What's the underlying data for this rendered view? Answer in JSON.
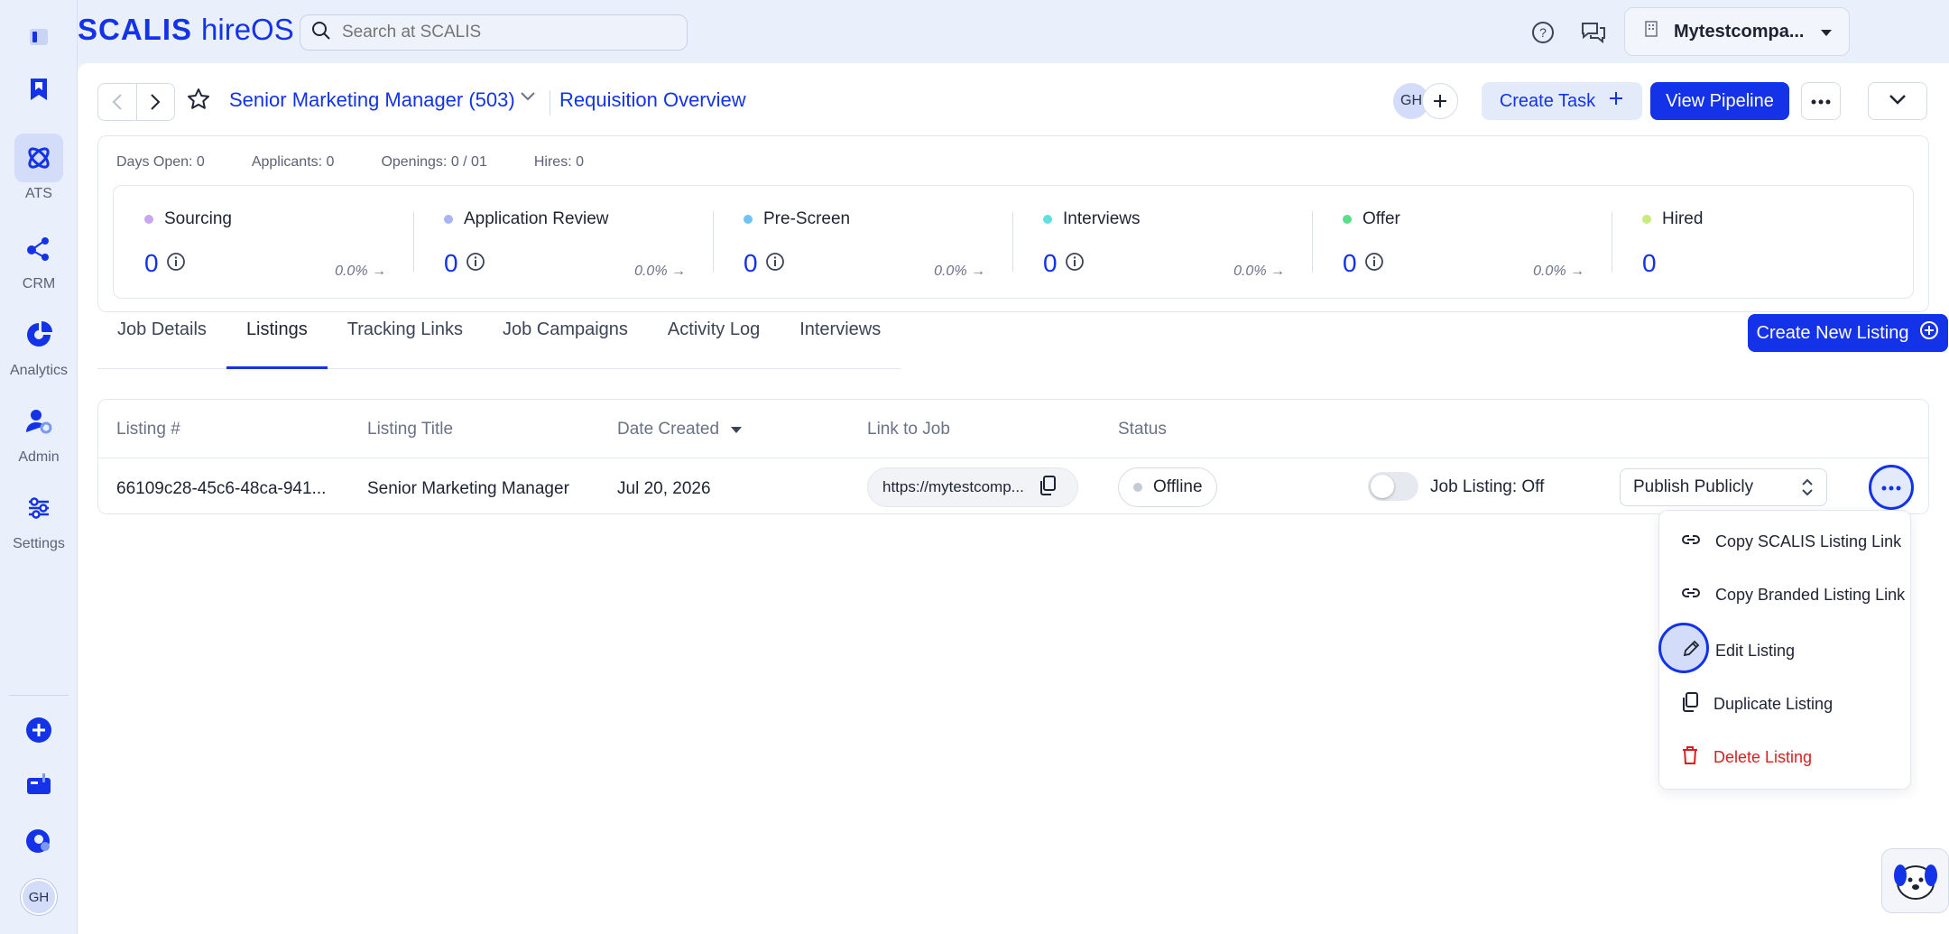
{
  "brand": {
    "name": "SCALIS",
    "product": "hireOS"
  },
  "search": {
    "placeholder": "Search at SCALIS"
  },
  "company": {
    "name": "Mytestcompa..."
  },
  "rail": {
    "items": [
      {
        "label": "ATS"
      },
      {
        "label": "CRM"
      },
      {
        "label": "Analytics"
      },
      {
        "label": "Admin"
      },
      {
        "label": "Settings"
      }
    ],
    "user_initials": "GH"
  },
  "header": {
    "job_title": "Senior Marketing Manager (503)",
    "requisition_link": "Requisition Overview",
    "assignee_initials": "GH",
    "create_task": "Create Task",
    "view_pipeline": "View Pipeline"
  },
  "metrics": {
    "days_open": "Days Open: 0",
    "applicants": "Applicants: 0",
    "openings": "Openings: 0 / 01",
    "hires": "Hires: 0"
  },
  "stages": [
    {
      "name": "Sourcing",
      "count": "0",
      "pct": "0.0% →",
      "color": "#c9a6f0"
    },
    {
      "name": "Application Review",
      "count": "0",
      "pct": "0.0% →",
      "color": "#a9b4f2"
    },
    {
      "name": "Pre-Screen",
      "count": "0",
      "pct": "0.0% →",
      "color": "#6cc3f5"
    },
    {
      "name": "Interviews",
      "count": "0",
      "pct": "0.0% →",
      "color": "#5fe0e0"
    },
    {
      "name": "Offer",
      "count": "0",
      "pct": "0.0% →",
      "color": "#5cdd8a"
    },
    {
      "name": "Hired",
      "count": "0",
      "pct": "",
      "color": "#c6ec7a"
    }
  ],
  "tabs": [
    "Job Details",
    "Listings",
    "Tracking Links",
    "Job Campaigns",
    "Activity Log",
    "Interviews"
  ],
  "active_tab": "Listings",
  "create_listing": "Create New Listing",
  "table": {
    "headers": [
      "Listing #",
      "Listing Title",
      "Date Created",
      "Link to Job",
      "Status"
    ],
    "row": {
      "listing_id": "66109c28-45c6-48ca-941...",
      "title": "Senior Marketing Manager",
      "date": "Jul 20, 2026",
      "link": "https://mytestcomp...",
      "status": "Offline",
      "toggle_label": "Job Listing: Off",
      "publish_option": "Publish Publicly"
    }
  },
  "menu": {
    "items": [
      {
        "label": "Copy SCALIS Listing Link"
      },
      {
        "label": "Copy Branded Listing Link"
      },
      {
        "label": "Edit Listing"
      },
      {
        "label": "Duplicate Listing"
      },
      {
        "label": "Delete Listing"
      }
    ]
  },
  "colors": {
    "accent": "#1433e8",
    "danger": "#d81f1f"
  }
}
